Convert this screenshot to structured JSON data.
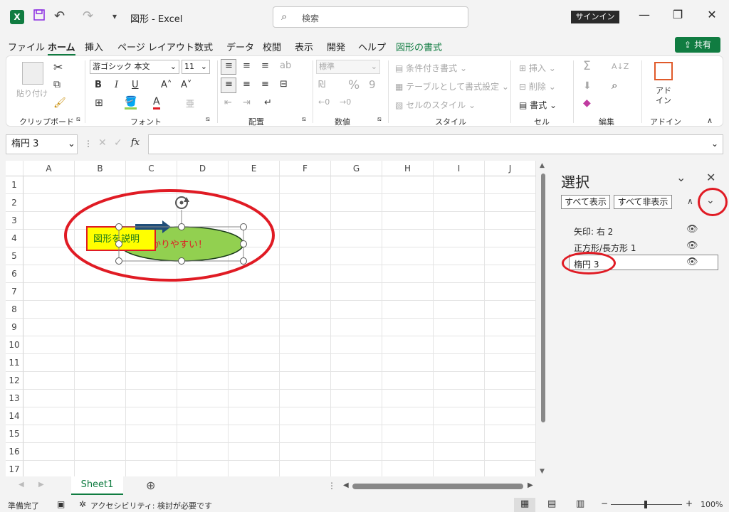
{
  "window": {
    "title": "図形  -  Excel",
    "search_placeholder": "検索",
    "signin": "サインイン",
    "min": "—",
    "restore": "❐",
    "close": "✕"
  },
  "qat": {
    "logo": "X",
    "save": "💾",
    "undo": "↶",
    "redo": "↷",
    "customize": "▾"
  },
  "tabs": [
    "ファイル",
    "ホーム",
    "挿入",
    "ページ レイアウト",
    "数式",
    "データ",
    "校閲",
    "表示",
    "開発",
    "ヘルプ",
    "図形の書式"
  ],
  "share": "共有",
  "ribbon": {
    "clipboard": {
      "label": "クリップボード",
      "paste": "貼り付け"
    },
    "font": {
      "label": "フォント",
      "name": "游ゴシック 本文",
      "size": "11",
      "bold": "B",
      "italic": "I",
      "underline": "U",
      "grow": "A˄",
      "shrink": "A˅"
    },
    "alignment": {
      "label": "配置"
    },
    "number": {
      "label": "数値",
      "format": "標準",
      "currency": "₪",
      "percent": "%",
      "comma": "9"
    },
    "styles": {
      "label": "スタイル",
      "conditional": "条件付き書式",
      "table": "テーブルとして書式設定",
      "cell": "セルのスタイル"
    },
    "cells": {
      "label": "セル",
      "insert": "挿入",
      "delete": "削除",
      "format": "書式"
    },
    "editing": {
      "label": "編集",
      "sum": "Σ",
      "sort": "A↓Z"
    },
    "addins": {
      "label": "アドイン",
      "name": "アド\nイン"
    }
  },
  "formula": {
    "namebox": "楕円 3",
    "fx": "fx"
  },
  "columns": [
    "A",
    "B",
    "C",
    "D",
    "E",
    "F",
    "G",
    "H",
    "I",
    "J"
  ],
  "rows": [
    "1",
    "2",
    "3",
    "4",
    "5",
    "6",
    "7",
    "8",
    "9",
    "10",
    "11",
    "12",
    "13",
    "14",
    "15",
    "16",
    "17"
  ],
  "shapes": {
    "rect_text": "図形を説明",
    "ellipse_text": "わかりやすい！"
  },
  "selection_pane": {
    "title": "選択",
    "show_all": "すべて表示",
    "hide_all": "すべて非表示",
    "items": [
      {
        "label": "矢印: 右 2"
      },
      {
        "label": "正方形/長方形 1"
      },
      {
        "label": "楕円 3"
      }
    ]
  },
  "sheet": {
    "name": "Sheet1",
    "add": "⊕"
  },
  "status": {
    "ready": "準備完了",
    "accessibility": "アクセシビリティ: 検討が必要です",
    "zoom": "100%"
  },
  "colors": {
    "accent": "#107c41",
    "annotation": "#e01b24",
    "ellipse_fill": "#92d050",
    "rect_fill": "#ffff00",
    "arrow_fill": "#1f4e79"
  }
}
